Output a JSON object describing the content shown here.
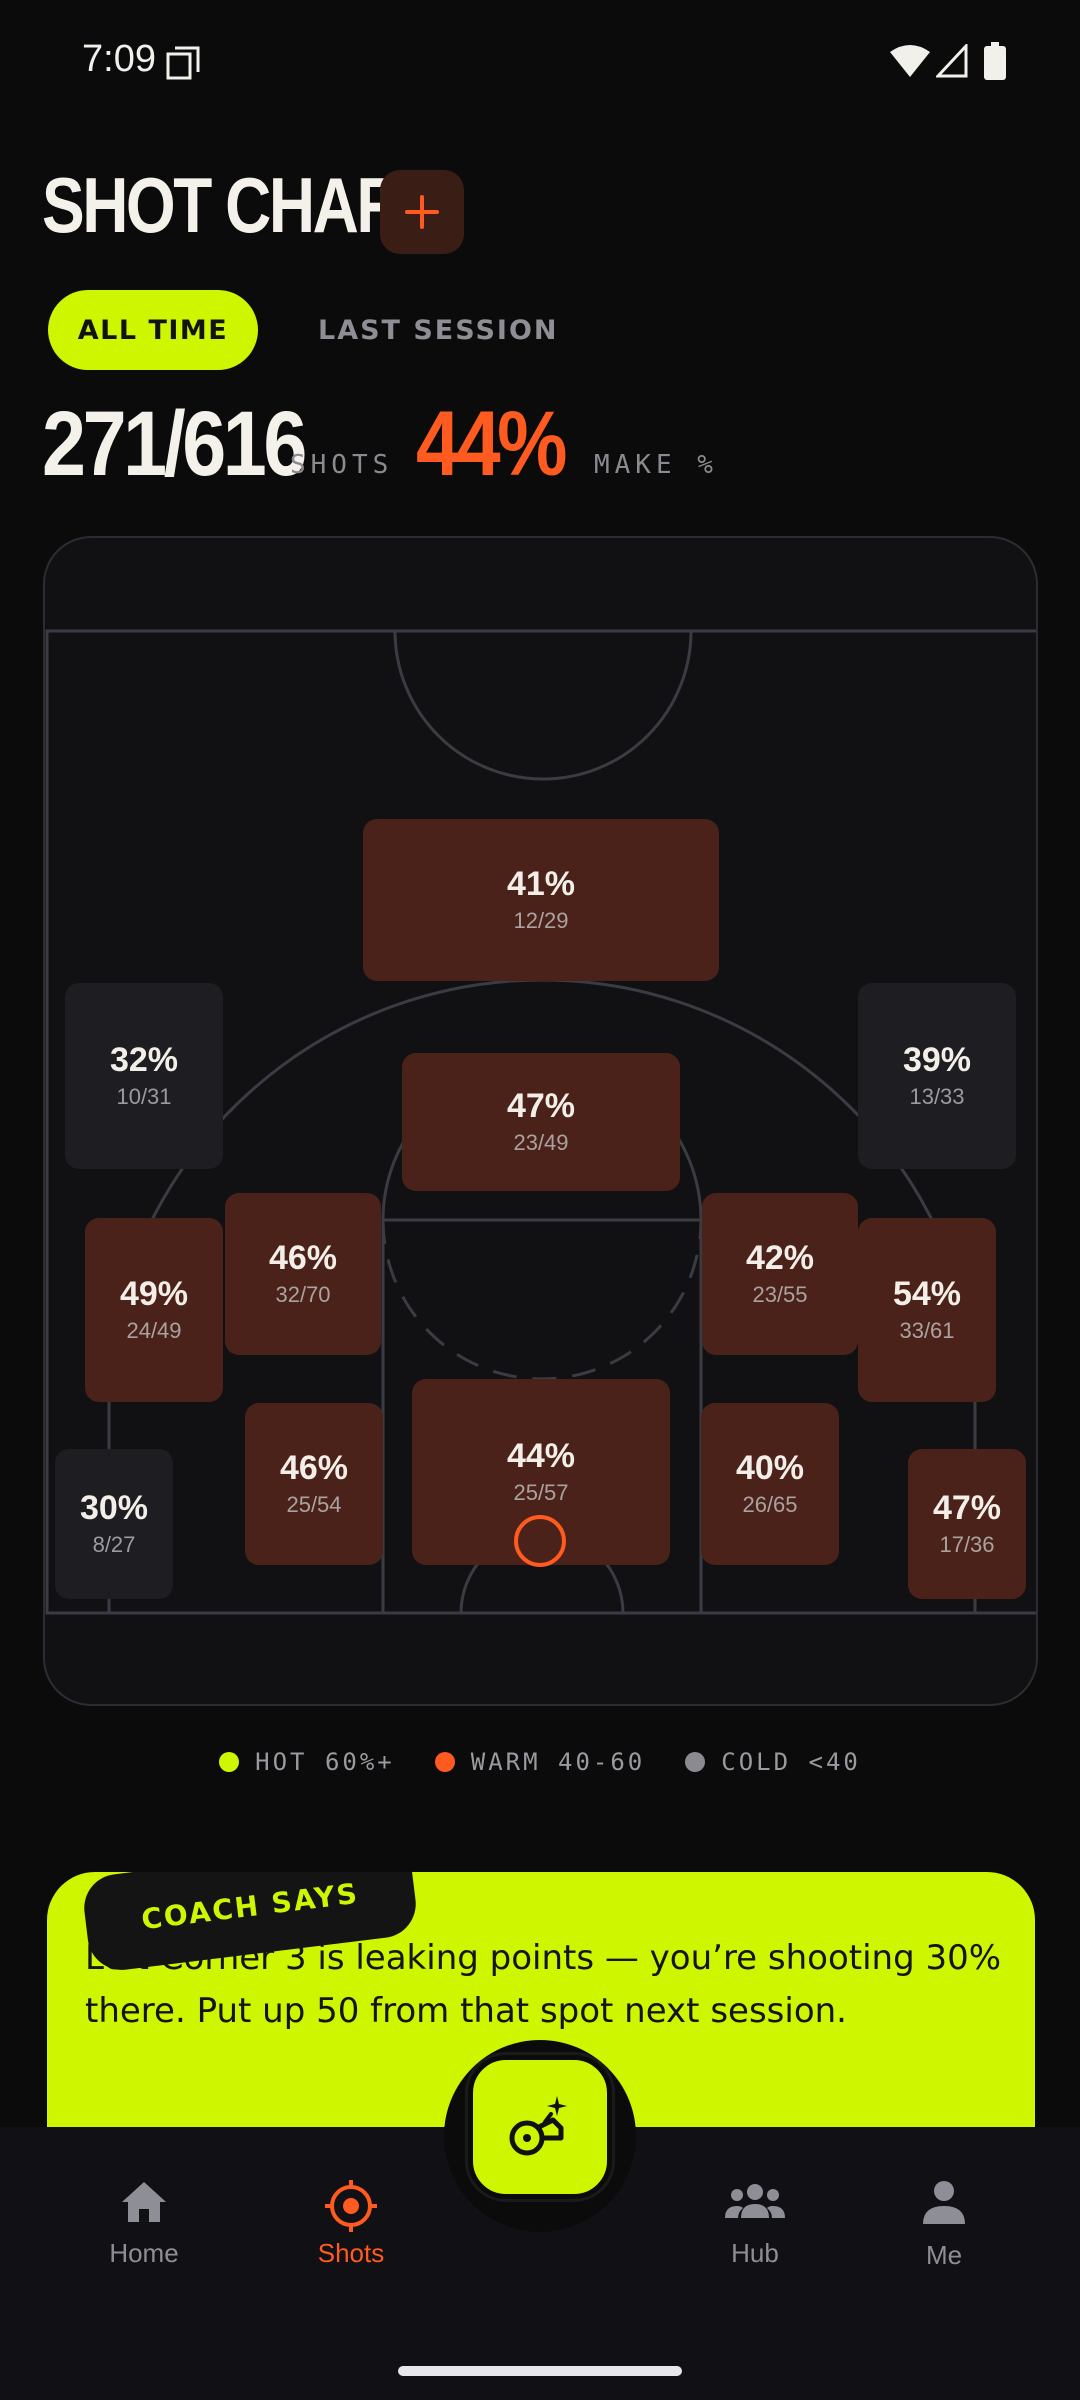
{
  "status_bar": {
    "time": "7:09"
  },
  "header": {
    "title": "SHOT CHART",
    "add_label": "+"
  },
  "tabs": {
    "active": "ALL TIME",
    "inactive": "LAST SESSION"
  },
  "stats": {
    "shots_value": "271/616",
    "shots_label": "SHOTS",
    "make_value": "44%",
    "make_label": "MAKE %"
  },
  "zones": [
    {
      "id": "top-key",
      "pct": "41%",
      "frac": "12/29",
      "temp": "warm"
    },
    {
      "id": "left-wing-3",
      "pct": "32%",
      "frac": "10/31",
      "temp": "cold"
    },
    {
      "id": "right-wing-3",
      "pct": "39%",
      "frac": "13/33",
      "temp": "cold"
    },
    {
      "id": "free-throw",
      "pct": "47%",
      "frac": "23/49",
      "temp": "warm"
    },
    {
      "id": "left-baseline-3",
      "pct": "49%",
      "frac": "24/49",
      "temp": "warm"
    },
    {
      "id": "left-elbow",
      "pct": "46%",
      "frac": "32/70",
      "temp": "warm"
    },
    {
      "id": "right-elbow",
      "pct": "42%",
      "frac": "23/55",
      "temp": "warm"
    },
    {
      "id": "right-baseline-3",
      "pct": "54%",
      "frac": "33/61",
      "temp": "warm"
    },
    {
      "id": "left-corner-3",
      "pct": "30%",
      "frac": "8/27",
      "temp": "cold"
    },
    {
      "id": "left-short",
      "pct": "46%",
      "frac": "25/54",
      "temp": "warm"
    },
    {
      "id": "paint",
      "pct": "44%",
      "frac": "25/57",
      "temp": "warm"
    },
    {
      "id": "right-short",
      "pct": "40%",
      "frac": "26/65",
      "temp": "warm"
    },
    {
      "id": "right-corner-3",
      "pct": "47%",
      "frac": "17/36",
      "temp": "warm"
    }
  ],
  "legend": [
    {
      "label": "HOT 60%+",
      "color": "#cdf600"
    },
    {
      "label": "WARM 40-60",
      "color": "#ff5a1f"
    },
    {
      "label": "COLD <40",
      "color": "#8a8a90"
    }
  ],
  "coach": {
    "tag": "COACH SAYS",
    "message": "Left Corner 3 is leaking points — you’re shooting 30% there. Put up 50 from that spot next session."
  },
  "nav": {
    "home": "Home",
    "shots": "Shots",
    "hub": "Hub",
    "me": "Me"
  },
  "colors": {
    "accent": "#cdf600",
    "warm": "#ff5a1f",
    "background": "#0b0b0c"
  }
}
